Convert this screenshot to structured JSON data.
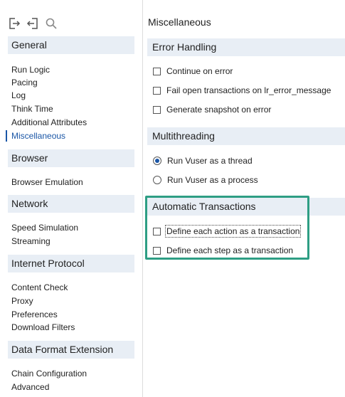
{
  "toolbar": {
    "icons": [
      "export-icon",
      "import-icon",
      "search-icon"
    ]
  },
  "sidebar": {
    "sections": [
      {
        "title": "General",
        "items": [
          "Run Logic",
          "Pacing",
          "Log",
          "Think Time",
          "Additional Attributes",
          "Miscellaneous"
        ]
      },
      {
        "title": "Browser",
        "items": [
          "Browser Emulation"
        ]
      },
      {
        "title": "Network",
        "items": [
          "Speed Simulation",
          "Streaming"
        ]
      },
      {
        "title": "Internet Protocol",
        "items": [
          "Content Check",
          "Proxy",
          "Preferences",
          "Download Filters"
        ]
      },
      {
        "title": "Data Format Extension",
        "items": [
          "Chain Configuration",
          "Advanced"
        ]
      }
    ],
    "active_item": "Miscellaneous"
  },
  "main": {
    "title": "Miscellaneous",
    "groups": [
      {
        "title": "Error Handling",
        "options": [
          {
            "label": "Continue on error",
            "type": "checkbox",
            "checked": false
          },
          {
            "label": "Fail open transactions on lr_error_message",
            "type": "checkbox",
            "checked": false
          },
          {
            "label": "Generate snapshot on error",
            "type": "checkbox",
            "checked": false
          }
        ]
      },
      {
        "title": "Multithreading",
        "options": [
          {
            "label": "Run Vuser as a thread",
            "type": "radio",
            "checked": true
          },
          {
            "label": "Run Vuser as a process",
            "type": "radio",
            "checked": false
          }
        ]
      },
      {
        "title": "Automatic Transactions",
        "options": [
          {
            "label": "Define each action as a transaction",
            "type": "checkbox",
            "checked": false
          },
          {
            "label": "Define each step as a transaction",
            "type": "checkbox",
            "checked": false
          }
        ]
      }
    ]
  },
  "colors": {
    "accent": "#1a56a6",
    "highlight_border": "#2e9e84",
    "section_bg": "#e8eef5"
  }
}
